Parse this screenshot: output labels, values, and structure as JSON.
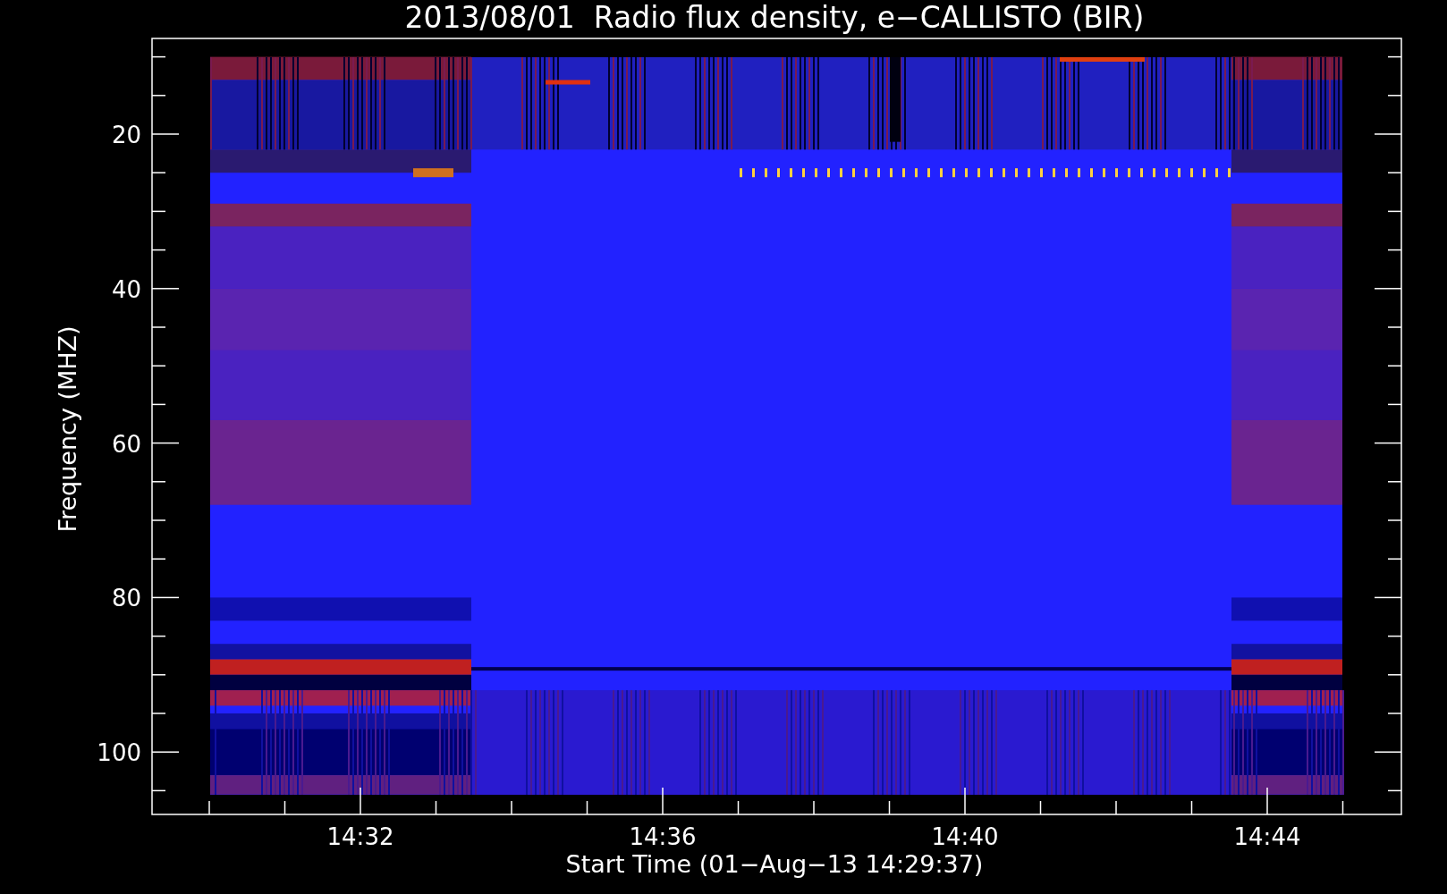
{
  "title": "2013/08/01  Radio flux density, e−CALLISTO (BIR)",
  "y_axis": {
    "label": "Frequency (MHZ)",
    "ticks": [
      "20",
      "40",
      "60",
      "80",
      "100"
    ]
  },
  "x_axis": {
    "label": "Start Time (01−Aug−13 14:29:37)",
    "ticks": [
      "14:32",
      "14:36",
      "14:40",
      "14:44"
    ]
  }
}
